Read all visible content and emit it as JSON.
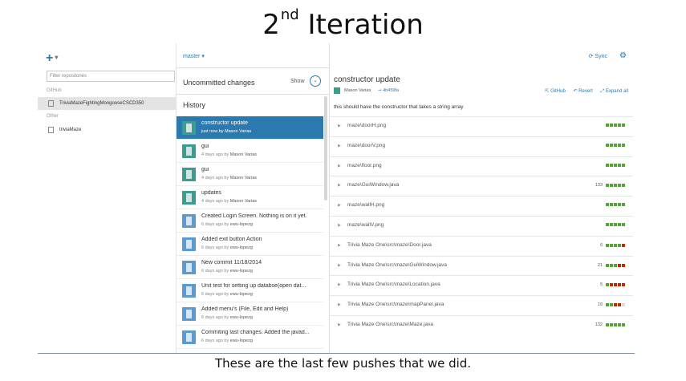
{
  "slide": {
    "title_main": "2",
    "title_sup": "nd",
    "title_rest": " Iteration",
    "caption": "These are the last few pushes that we did."
  },
  "sidebar": {
    "add_label": "+",
    "add_caret": "▾",
    "filter_placeholder": "Filter repositories",
    "github_group": "GitHub",
    "github_repo": "TriviaMazeFightingMongooseCSCD350",
    "other_group": "Other",
    "other_repo": "triviaMaze"
  },
  "middle": {
    "branch": "master ▾",
    "uncommitted": "Uncommitted changes",
    "show": "Show",
    "show_icon": "⌄",
    "history": "History",
    "commits": [
      {
        "message": "constructor update",
        "time": "just now by",
        "author": "Mason Varias"
      },
      {
        "message": "gui",
        "time": "4 days ago by",
        "author": "Mason Varias"
      },
      {
        "message": "gui",
        "time": "4 days ago by",
        "author": "Mason Varias"
      },
      {
        "message": "updates",
        "time": "4 days ago by",
        "author": "Mason Varias"
      },
      {
        "message": "Created Login Screen. Nothing is on it yet.",
        "time": "6 days ago by",
        "author": "ewu-lopezg"
      },
      {
        "message": "Added exit button Action",
        "time": "6 days ago by",
        "author": "ewu-lopezg"
      },
      {
        "message": "New commit 11/18/2014",
        "time": "6 days ago by",
        "author": "ewu-lopezg"
      },
      {
        "message": "Unit test for setting up databse(open dat...",
        "time": "6 days ago by",
        "author": "ewu-lopezg"
      },
      {
        "message": "Added menu's (File, Edit and Help)",
        "time": "6 days ago by",
        "author": "ewu-lopezg"
      },
      {
        "message": "Commiting last changes. Added the javad...",
        "time": "6 days ago by",
        "author": "ewu-lopezg"
      }
    ]
  },
  "detail": {
    "sync": "⟳ Sync",
    "gear": "⚙",
    "title": "constructor update",
    "author": "Mason Varias",
    "sha": "⊸ 4b459fa",
    "github_link": "⇱ GitHub",
    "revert_link": "↶ Revert",
    "expand_link": "⤢ Expand all",
    "description": "this should have the constructor that takes a string array",
    "files": [
      {
        "path": "maze\\doorH.png",
        "count": "",
        "bars": "ggggg"
      },
      {
        "path": "maze\\doorV.png",
        "count": "",
        "bars": "ggggg"
      },
      {
        "path": "maze\\floor.png",
        "count": "",
        "bars": "ggggg"
      },
      {
        "path": "maze\\GuiWindow.java",
        "count": "133",
        "bars": "ggggg"
      },
      {
        "path": "maze\\wallH.png",
        "count": "",
        "bars": "ggggg"
      },
      {
        "path": "maze\\wallV.png",
        "count": "",
        "bars": "ggggg"
      },
      {
        "path": "Trivia Maze One\\src\\maze\\Door.java",
        "count": "6",
        "bars": "ggggr"
      },
      {
        "path": "Trivia Maze One\\src\\maze\\GuiWindow.java",
        "count": "21",
        "bars": "gggrr"
      },
      {
        "path": "Trivia Maze One\\src\\maze\\Location.java",
        "count": "5",
        "bars": "grrrr"
      },
      {
        "path": "Trivia Maze One\\src\\maze\\mapPanel.java",
        "count": "19",
        "bars": "ggrre"
      },
      {
        "path": "Trivia Maze One\\src\\maze\\Maze.java",
        "count": "132",
        "bars": "ggggg"
      }
    ]
  }
}
